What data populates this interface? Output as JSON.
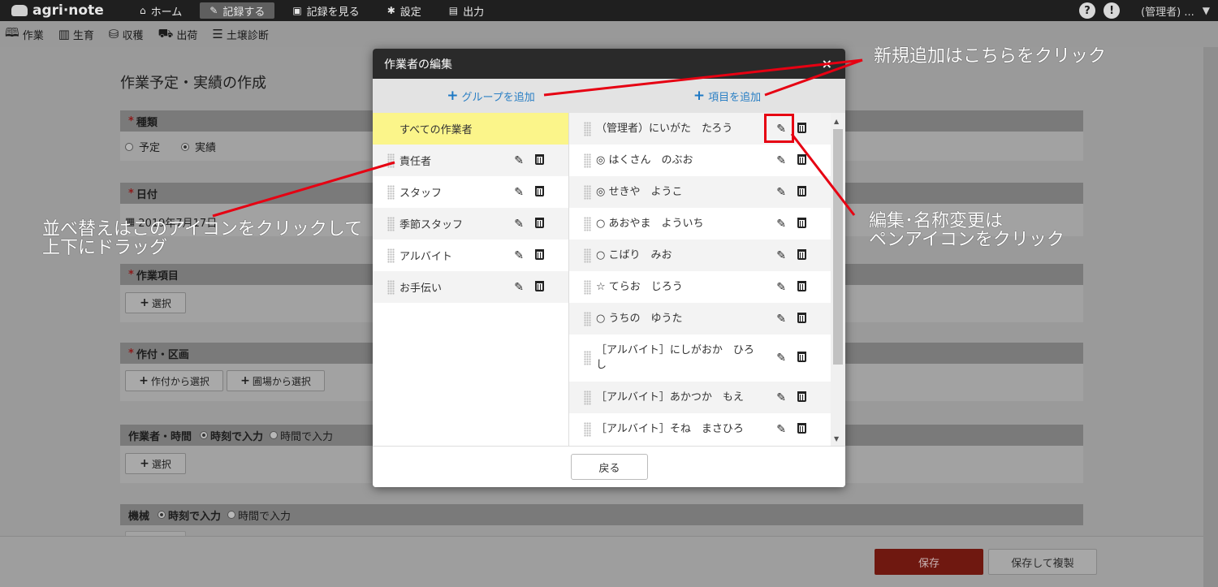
{
  "app": {
    "logo": "agri·note"
  },
  "topnav": [
    {
      "label": "ホーム",
      "icon": "home-icon",
      "glyph": "⌂"
    },
    {
      "label": "記録する",
      "icon": "pencil-icon",
      "glyph": "✎"
    },
    {
      "label": "記録を見る",
      "icon": "book-icon",
      "glyph": "▣"
    },
    {
      "label": "設定",
      "icon": "gear-icon",
      "glyph": "✱"
    },
    {
      "label": "出力",
      "icon": "file-icon",
      "glyph": "▤"
    }
  ],
  "topright": {
    "help": "?",
    "info": "!",
    "user": "(管理者) ..."
  },
  "subnav": [
    {
      "label": "作業",
      "icon": "book-open-icon"
    },
    {
      "label": "生育",
      "icon": "growth-chart-icon"
    },
    {
      "label": "収穫",
      "icon": "basket-icon"
    },
    {
      "label": "出荷",
      "icon": "truck-icon"
    },
    {
      "label": "土壌診断",
      "icon": "sliders-icon"
    }
  ],
  "form": {
    "title": "作業予定・実績の作成",
    "type_label": "種類",
    "type_opt1": "予定",
    "type_opt2": "実績",
    "date_label": "日付",
    "date_value": "2019年7月17日",
    "item_label": "作業項目",
    "select": "選択",
    "plot_label": "作付・区画",
    "from_crop": "作付から選択",
    "from_field": "圃場から選択",
    "worker_label": "作業者・時間",
    "time_mode1": "時刻で入力",
    "time_mode2": "時間で入力",
    "machine_label": "機械",
    "save": "保存",
    "save_copy": "保存して複製"
  },
  "modal": {
    "title": "作業者の編集",
    "close": "×",
    "add_group": "グループを追加",
    "add_item": "項目を追加",
    "back": "戻る",
    "groups": [
      "すべての作業者",
      "責任者",
      "スタッフ",
      "季節スタッフ",
      "アルバイト",
      "お手伝い"
    ],
    "workers": [
      "（管理者）にいがた　たろう",
      "◎ はくさん　のぶお",
      "◎ せきや　ようこ",
      "○ あおやま　よういち",
      "○ こばり　みお",
      "☆ てらお　じろう",
      "○ うちの　ゆうた",
      "［アルバイト］にしがおか　ひろし",
      "［アルバイト］あかつか　もえ",
      "［アルバイト］そね　まさひろ"
    ]
  },
  "annotations": {
    "add_new": "新規追加はこちらをクリック",
    "edit_line1": "編集･名称変更は",
    "edit_line2": "ペンアイコンをクリック",
    "sort_line1": "並べ替えはこのアイコンをクリックして",
    "sort_line2": "上下にドラッグ",
    "color": "#e60012"
  }
}
